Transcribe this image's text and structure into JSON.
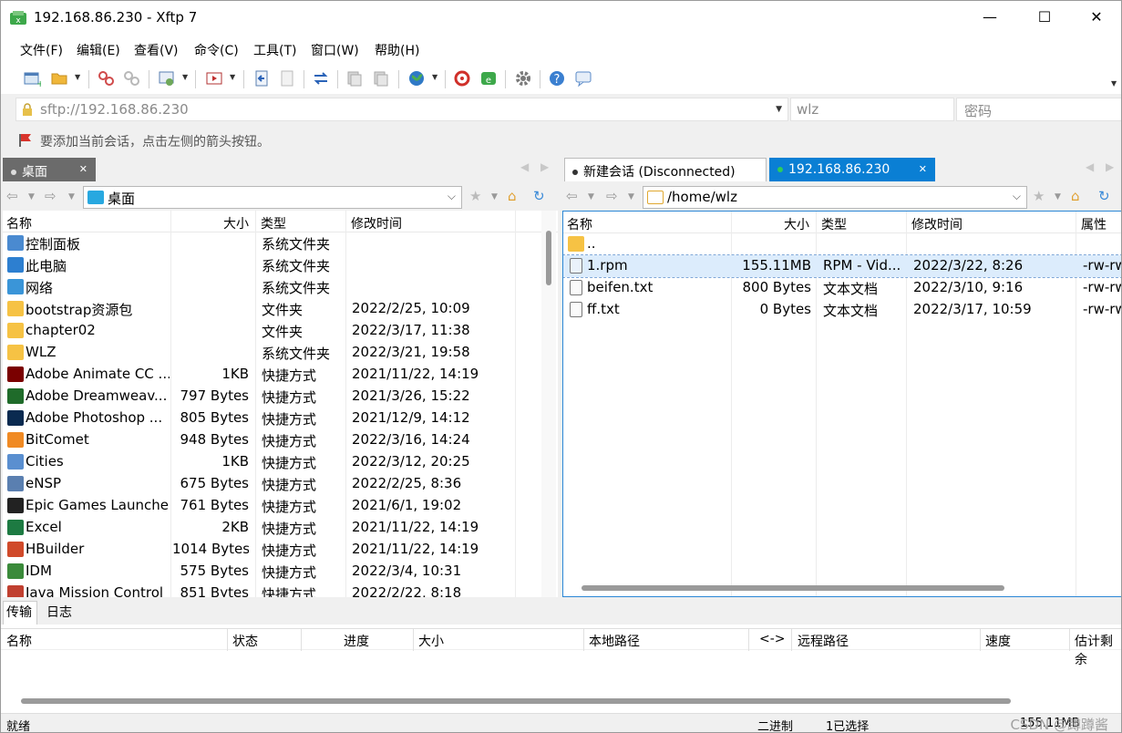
{
  "window": {
    "title": "192.168.86.230 - Xftp 7",
    "minimize": "—",
    "maximize": "☐",
    "close": "✕"
  },
  "menu": [
    "文件(F)",
    "编辑(E)",
    "查看(V)",
    "命令(C)",
    "工具(T)",
    "窗口(W)",
    "帮助(H)"
  ],
  "address": {
    "value": "sftp://192.168.86.230",
    "username": "wlz",
    "password_placeholder": "密码"
  },
  "hint": "要添加当前会话，点击左侧的箭头按钮。",
  "left_pane": {
    "tab": "桌面",
    "path": "桌面",
    "columns": [
      "名称",
      "大小",
      "类型",
      "修改时间"
    ],
    "rows": [
      {
        "name": "控制面板",
        "size": "",
        "type": "系统文件夹",
        "modified": "",
        "icon": "control-panel-icon"
      },
      {
        "name": "此电脑",
        "size": "",
        "type": "系统文件夹",
        "modified": "",
        "icon": "computer-icon"
      },
      {
        "name": "网络",
        "size": "",
        "type": "系统文件夹",
        "modified": "",
        "icon": "network-icon"
      },
      {
        "name": "bootstrap资源包",
        "size": "",
        "type": "文件夹",
        "modified": "2022/2/25, 10:09",
        "icon": "folder-icon"
      },
      {
        "name": "chapter02",
        "size": "",
        "type": "文件夹",
        "modified": "2022/3/17, 11:38",
        "icon": "folder-icon"
      },
      {
        "name": "WLZ",
        "size": "",
        "type": "系统文件夹",
        "modified": "2022/3/21, 19:58",
        "icon": "folder-icon"
      },
      {
        "name": "Adobe Animate CC ...",
        "size": "1KB",
        "type": "快捷方式",
        "modified": "2021/11/22, 14:19",
        "icon": "animate-icon"
      },
      {
        "name": "Adobe Dreamweav...",
        "size": "797 Bytes",
        "type": "快捷方式",
        "modified": "2021/3/26, 15:22",
        "icon": "dreamweaver-icon"
      },
      {
        "name": "Adobe Photoshop ...",
        "size": "805 Bytes",
        "type": "快捷方式",
        "modified": "2021/12/9, 14:12",
        "icon": "photoshop-icon"
      },
      {
        "name": "BitComet",
        "size": "948 Bytes",
        "type": "快捷方式",
        "modified": "2022/3/16, 14:24",
        "icon": "bitcomet-icon"
      },
      {
        "name": "Cities",
        "size": "1KB",
        "type": "快捷方式",
        "modified": "2022/3/12, 20:25",
        "icon": "cities-icon"
      },
      {
        "name": "eNSP",
        "size": "675 Bytes",
        "type": "快捷方式",
        "modified": "2022/2/25, 8:36",
        "icon": "ensp-icon"
      },
      {
        "name": "Epic Games Launcher",
        "size": "761 Bytes",
        "type": "快捷方式",
        "modified": "2021/6/1, 19:02",
        "icon": "epic-icon"
      },
      {
        "name": "Excel",
        "size": "2KB",
        "type": "快捷方式",
        "modified": "2021/11/22, 14:19",
        "icon": "excel-icon"
      },
      {
        "name": "HBuilder",
        "size": "1014 Bytes",
        "type": "快捷方式",
        "modified": "2021/11/22, 14:19",
        "icon": "hbuilder-icon"
      },
      {
        "name": "IDM",
        "size": "575 Bytes",
        "type": "快捷方式",
        "modified": "2022/3/4, 10:31",
        "icon": "idm-icon"
      },
      {
        "name": "Java Mission Control",
        "size": "851 Bytes",
        "type": "快捷方式",
        "modified": "2022/2/22, 8:18",
        "icon": "java-icon"
      }
    ]
  },
  "right_pane": {
    "tabs": [
      {
        "label": "新建会话 (Disconnected)"
      },
      {
        "label": "192.168.86.230"
      }
    ],
    "path": "/home/wlz",
    "columns": [
      "名称",
      "大小",
      "类型",
      "修改时间",
      "属性"
    ],
    "rows": [
      {
        "name": "..",
        "size": "",
        "type": "",
        "modified": "",
        "attr": "",
        "icon": "folder-icon"
      },
      {
        "name": "1.rpm",
        "size": "155.11MB",
        "type": "RPM - Vid...",
        "modified": "2022/3/22, 8:26",
        "attr": "-rw-rw",
        "icon": "video-file-icon"
      },
      {
        "name": "beifen.txt",
        "size": "800 Bytes",
        "type": "文本文档",
        "modified": "2022/3/10, 9:16",
        "attr": "-rw-rw",
        "icon": "text-file-icon"
      },
      {
        "name": "ff.txt",
        "size": "0 Bytes",
        "type": "文本文档",
        "modified": "2022/3/17, 10:59",
        "attr": "-rw-rw",
        "icon": "text-file-icon"
      }
    ]
  },
  "bottom": {
    "tabs": [
      "传输",
      "日志"
    ],
    "columns": [
      "名称",
      "状态",
      "进度",
      "大小",
      "本地路径",
      "<->",
      "远程路径",
      "速度",
      "估计剩余"
    ]
  },
  "status": {
    "left": "就绪",
    "mode": "二进制",
    "selection": "1已选择",
    "size": "155.11MB"
  },
  "watermark": "CSDN @蹲蹲酱",
  "colors": {
    "accent": "#0a7fd4",
    "folder": "#f6c244",
    "connected": "#1ea84a"
  }
}
